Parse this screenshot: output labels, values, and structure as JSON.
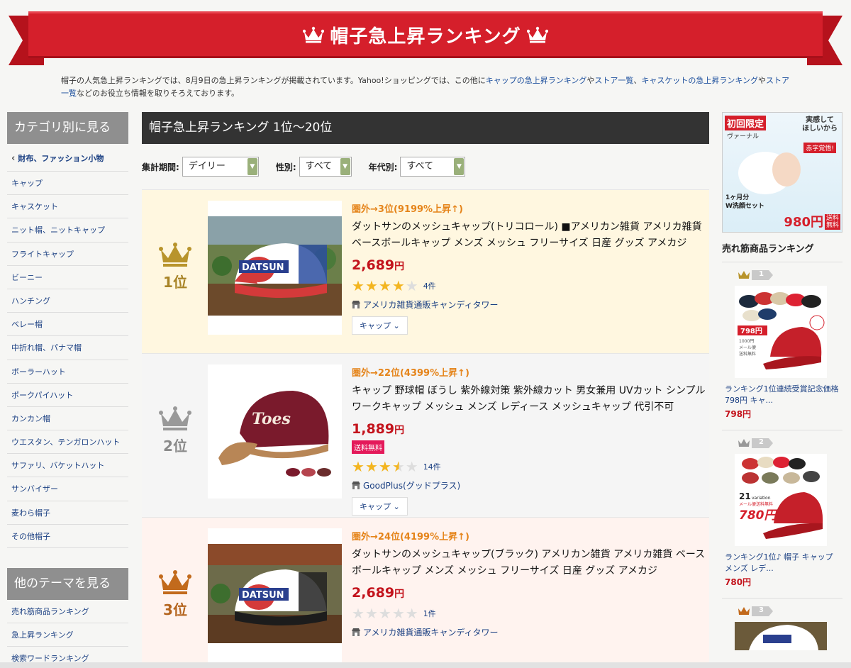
{
  "banner": {
    "title": "帽子急上昇ランキング"
  },
  "intro": {
    "part1": "帽子の人気急上昇ランキングでは、8月9日の急上昇ランキングが掲載されています。Yahoo!ショッピングでは、この他に",
    "link1": "キャップの急上昇ランキング",
    "part2": "や",
    "link2": "ストア一覧",
    "part3": "、",
    "link3": "キャスケットの急上昇ランキング",
    "part4": "や",
    "link4": "ストア一覧",
    "part5": "などのお役立ち情報を取りそろえております。"
  },
  "sidebar": {
    "heading": "カテゴリ別に見る",
    "category": "財布、ファッション小物",
    "items": [
      "キャップ",
      "キャスケット",
      "ニット帽、ニットキャップ",
      "フライトキャップ",
      "ビーニー",
      "ハンチング",
      "ベレー帽",
      "中折れ帽、パナマ帽",
      "ボーラーハット",
      "ポークパイハット",
      "カンカン帽",
      "ウエスタン、テンガロンハット",
      "サファリ、バケットハット",
      "サンバイザー",
      "麦わら帽子",
      "その他帽子"
    ],
    "heading2": "他のテーマを見る",
    "themes": [
      "売れ筋商品ランキング",
      "急上昇ランキング",
      "検索ワードランキング"
    ]
  },
  "main": {
    "heading": "帽子急上昇ランキング 1位〜20位",
    "filters": [
      {
        "label": "集計期間:",
        "value": "デイリー"
      },
      {
        "label": "性別:",
        "value": "すべて"
      },
      {
        "label": "年代別:",
        "value": "すべて"
      }
    ],
    "items": [
      {
        "rank": "1位",
        "rise": "圏外→3位(9199%上昇↑)",
        "title": "ダットサンのメッシュキャップ(トリコロール) ■アメリカン雑貨 アメリカ雑貨 ベースボールキャップ メンズ メッシュ フリーサイズ 日産 グッズ アメカジ",
        "price": "2,689",
        "yen": "円",
        "free_shipping": "",
        "rating": 4,
        "reviews": "4件",
        "store": "アメリカ雑貨通販キャンディタワー",
        "tag": "キャップ"
      },
      {
        "rank": "2位",
        "rise": "圏外→22位(4399%上昇↑)",
        "title": "キャップ 野球帽 ぼうし 紫外線対策 紫外線カット 男女兼用 UVカット シンプル ワークキャップ メッシュ メンズ レディース メッシュキャップ 代引不可",
        "price": "1,889",
        "yen": "円",
        "free_shipping": "送料無料",
        "rating": 3.5,
        "reviews": "14件",
        "store": "GoodPlus(グッドプラス)",
        "tag": "キャップ"
      },
      {
        "rank": "3位",
        "rise": "圏外→24位(4199%上昇↑)",
        "title": "ダットサンのメッシュキャップ(ブラック) アメリカン雑貨 アメリカ雑貨 ベースボールキャップ メンズ メッシュ フリーサイズ 日産 グッズ アメカジ",
        "price": "2,689",
        "yen": "円",
        "free_shipping": "",
        "rating": 0,
        "reviews": "1件",
        "store": "アメリカ雑貨通販キャンディタワー",
        "tag": "キャップ"
      }
    ]
  },
  "ad": {
    "t1": "初回限定",
    "t2": "ヴァーナル",
    "t3a": "実感して",
    "t3b": "ほしいから",
    "t4": "赤字覚悟!",
    "t5": "1ヶ月分",
    "t6": "W洗顔セット",
    "t7": "980円",
    "t8": "送料無料"
  },
  "right": {
    "heading": "売れ筋商品ランキング",
    "items": [
      {
        "badge": "1",
        "img_label_a": "798円",
        "img_label_b": "1000円",
        "img_label_c": "メール便",
        "img_label_d": "送料無料",
        "name": "ランキング1位連続受賞記念価格798円 キャ...",
        "price": "798円"
      },
      {
        "badge": "2",
        "img_label_a": "21",
        "img_label_b": "variation",
        "img_label_c": "メール便送料無料",
        "img_label_d": "780円",
        "name": "ランキング1位♪ 帽子 キャップ メンズ レデ...",
        "price": "780円"
      },
      {
        "badge": "3",
        "name": "",
        "price": ""
      }
    ]
  },
  "colors": {
    "brand_red": "#d51f2b",
    "link": "#1a3f82",
    "rise": "#e5841a",
    "price": "#c3131c",
    "gold": "#a88428",
    "silver": "#8a8a8a",
    "bronze": "#b4641e"
  }
}
